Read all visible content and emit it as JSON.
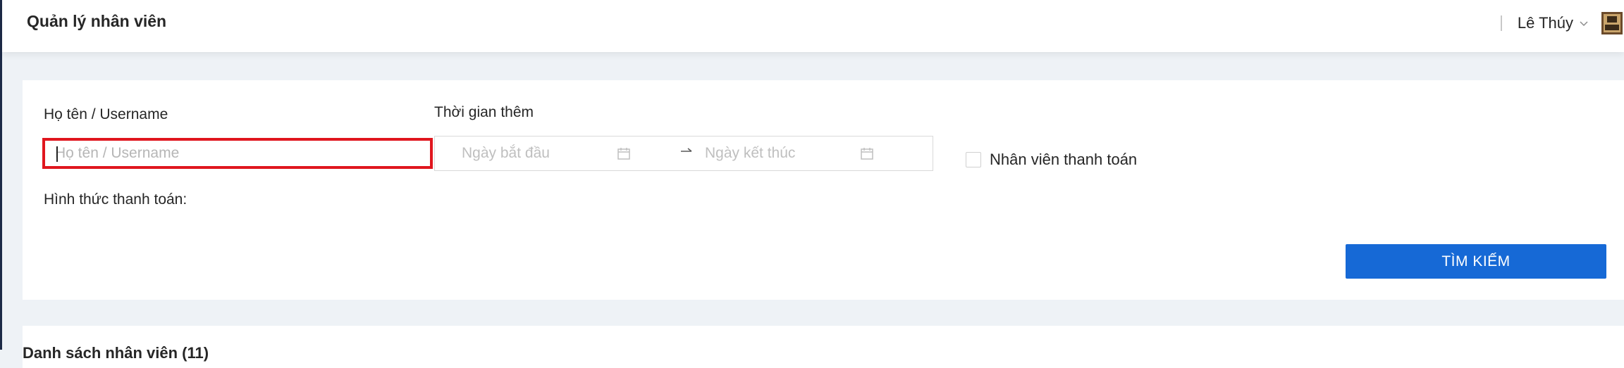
{
  "header": {
    "title": "Quản lý nhân viên",
    "user_name": "Lê Thúy"
  },
  "filters": {
    "name_label": "Họ tên / Username",
    "name_placeholder": "Họ tên / Username",
    "name_value": "",
    "date_label": "Thời gian thêm",
    "start_placeholder": "Ngày bắt đầu",
    "end_placeholder": "Ngày kết thúc",
    "payment_staff_label": "Nhân viên thanh toán",
    "payment_staff_checked": false,
    "payment_method_label": "Hình thức thanh toán:",
    "search_button": "TÌM KIẾM"
  },
  "results": {
    "title": "Danh sách nhân viên (11)"
  },
  "colors": {
    "accent": "#1669d6",
    "focus_border": "#e0161e",
    "page_bg": "#eef2f6"
  },
  "icons": {
    "calendar": "calendar-icon",
    "arrow": "arrow-right-icon",
    "chevron": "chevron-down-icon",
    "avatar": "avatar"
  }
}
